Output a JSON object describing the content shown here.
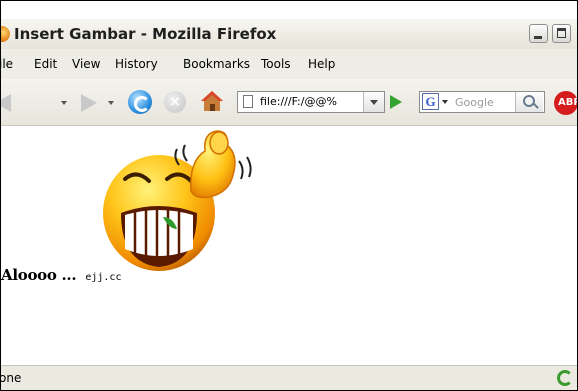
{
  "window": {
    "title": "Insert Gambar - Mozilla Firefox"
  },
  "menu": {
    "items": [
      "ile",
      "Edit",
      "View",
      "History",
      "Bookmarks",
      "Tools",
      "Help"
    ]
  },
  "toolbar": {
    "url": "file:///F:/@@%",
    "search_placeholder": "Google",
    "adblock_label": "ABP"
  },
  "content": {
    "caption": "Aloooo ...",
    "watermark": "ejj.cc",
    "image_icon": "grinning-smiley-thumbs-up"
  },
  "status": {
    "text": "one"
  },
  "colors": {
    "smiley_yellow": "#ffc51a",
    "smiley_orange": "#f08a00",
    "go_green": "#33a431",
    "adblock_red": "#d51d1d"
  }
}
